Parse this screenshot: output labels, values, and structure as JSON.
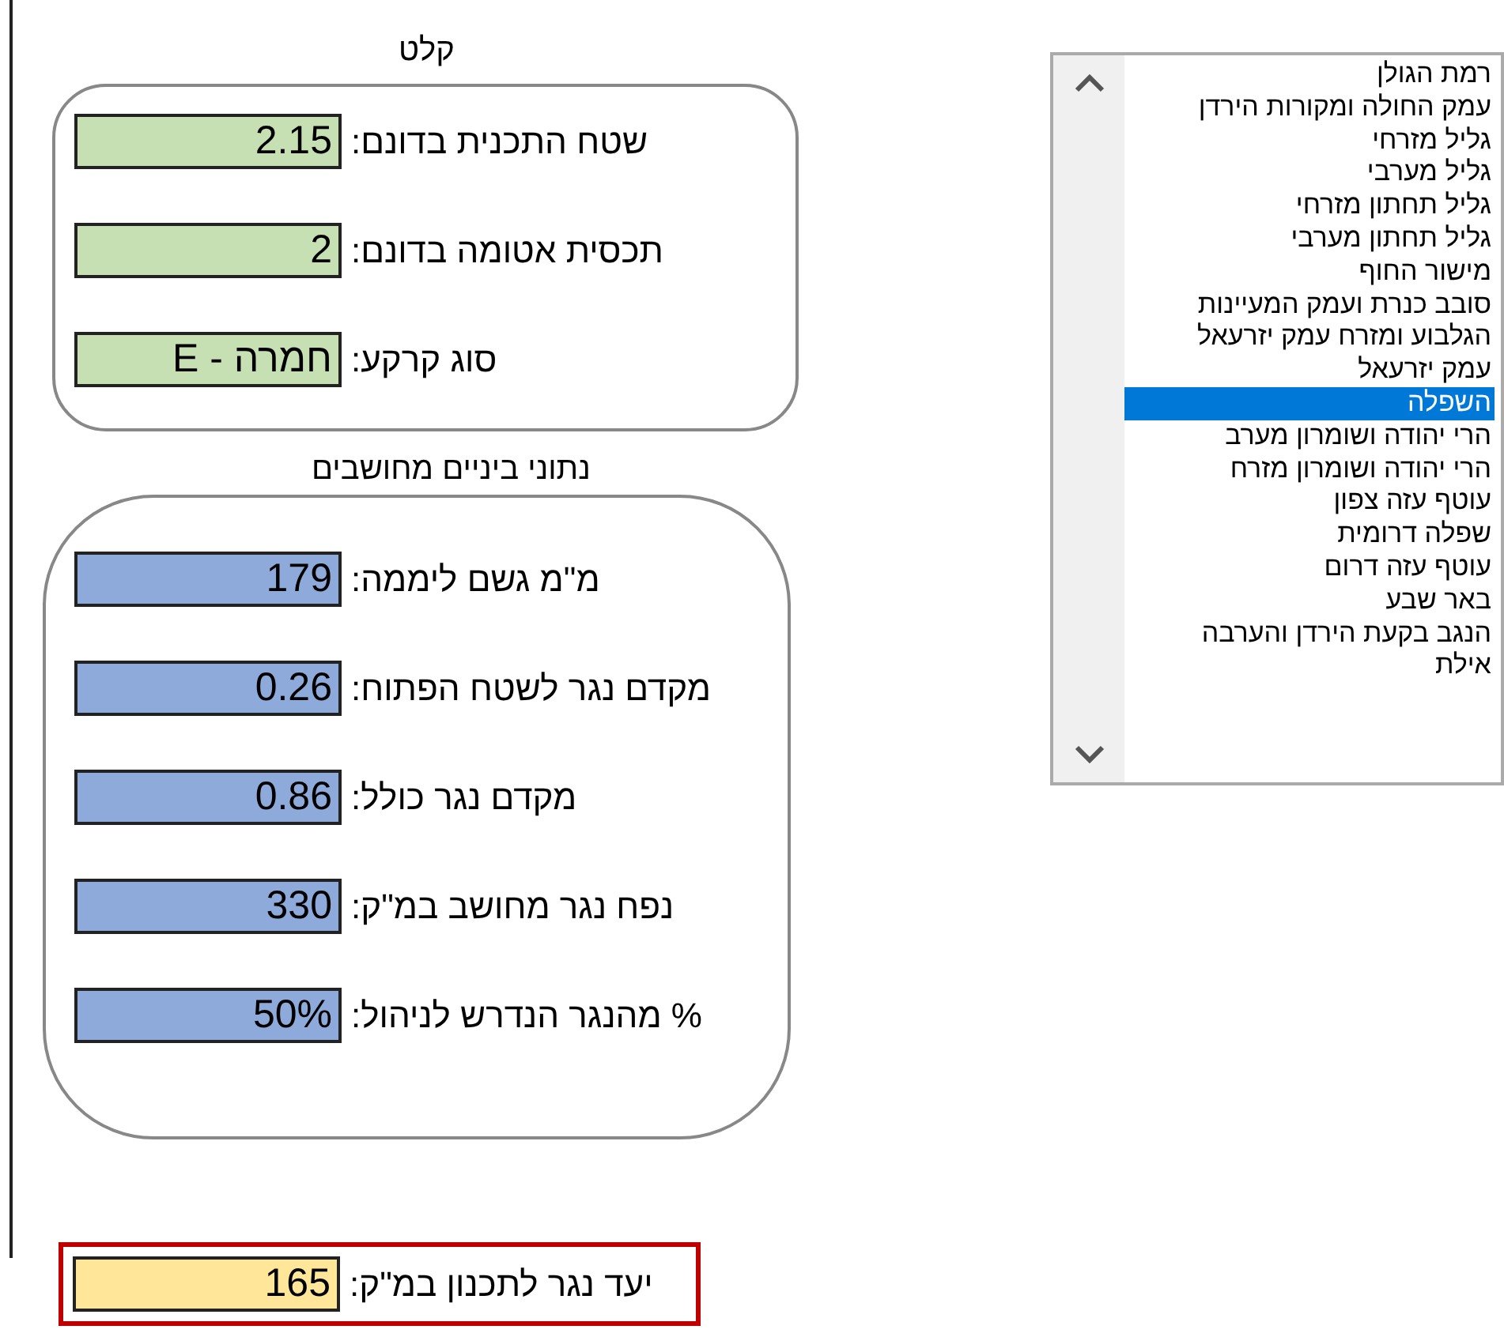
{
  "input_section": {
    "title": "קלט",
    "fields": [
      {
        "label": "שטח התכנית בדונם:",
        "value": "2.15"
      },
      {
        "label": "תכסית אטומה בדונם:",
        "value": "2"
      },
      {
        "label": "סוג קרקע:",
        "value": "חמרה - E"
      }
    ]
  },
  "computed_section": {
    "title": "נתוני ביניים מחושבים",
    "fields": [
      {
        "label": "מ\"מ גשם ליממה:",
        "value": "179"
      },
      {
        "label": "מקדם נגר לשטח הפתוח:",
        "value": "0.26"
      },
      {
        "label": "מקדם נגר כולל:",
        "value": "0.86"
      },
      {
        "label": "נפח נגר מחושב במ\"ק:",
        "value": "330"
      },
      {
        "label": "% מהנגר הנדרש לניהול:",
        "value": "50%"
      }
    ]
  },
  "target": {
    "label": "יעד נגר לתכנון במ\"ק:",
    "value": "165"
  },
  "region_list": [
    {
      "label": "רמת הגולן",
      "selected": false
    },
    {
      "label": "עמק החולה ומקורות הירדן",
      "selected": false
    },
    {
      "label": "גליל מזרחי",
      "selected": false
    },
    {
      "label": "גליל מערבי",
      "selected": false
    },
    {
      "label": "גליל תחתון מזרחי",
      "selected": false
    },
    {
      "label": "גליל תחתון מערבי",
      "selected": false
    },
    {
      "label": "מישור החוף",
      "selected": false
    },
    {
      "label": "סובב כנרת ועמק המעיינות",
      "selected": false
    },
    {
      "label": "הגלבוע ומזרח עמק יזרעאל",
      "selected": false
    },
    {
      "label": "עמק יזרעאל",
      "selected": false
    },
    {
      "label": "השפלה",
      "selected": true
    },
    {
      "label": "הרי יהודה ושומרון מערב",
      "selected": false
    },
    {
      "label": "הרי יהודה ושומרון מזרח",
      "selected": false
    },
    {
      "label": "עוטף עזה צפון",
      "selected": false
    },
    {
      "label": "שפלה דרומית",
      "selected": false
    },
    {
      "label": "עוטף עזה דרום",
      "selected": false
    },
    {
      "label": "באר שבע",
      "selected": false
    },
    {
      "label": "הנגב בקעת הירדן והערבה",
      "selected": false
    },
    {
      "label": "אילת",
      "selected": false
    }
  ]
}
